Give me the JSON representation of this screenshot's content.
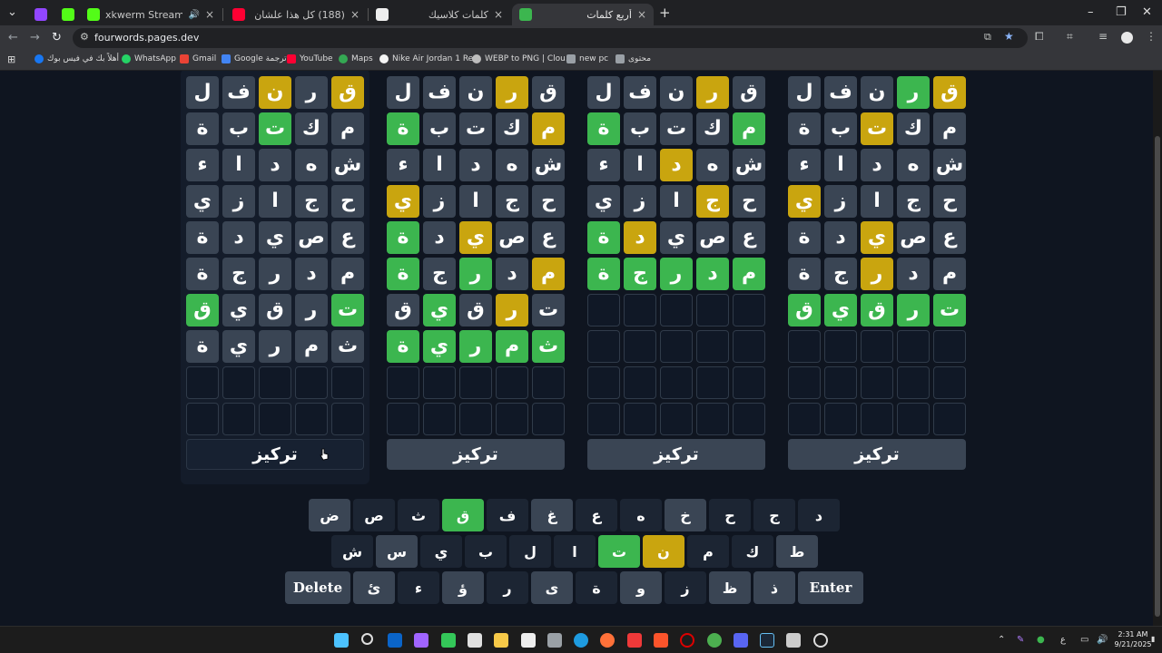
{
  "browser": {
    "tabs": [
      {
        "title": "",
        "active": false
      },
      {
        "title": "xkwerm Stream - Watch Live",
        "active": false
      },
      {
        "title": "(188) كل هذا علشان مخالفة - be",
        "active": false
      },
      {
        "title": "كلمات كلاسيك",
        "active": false
      },
      {
        "title": "أربع كلمات",
        "active": true
      }
    ],
    "new_tab": "+",
    "close_glyph": "×",
    "url": "fourwords.pages.dev",
    "bookmarks": [
      "أهلاً بك في فيس بوك",
      "WhatsApp",
      "Gmail",
      "Google ترجمة",
      "YouTube",
      "Maps",
      "Nike Air Jordan 1 Re...",
      "WEBP to PNG | Clou...",
      "new pc",
      "محتوى"
    ]
  },
  "game": {
    "focus_label": "تركيز",
    "boards": [
      {
        "focused": true,
        "rows": [
          [
            [
              "ق",
              "y"
            ],
            [
              "ر",
              "g"
            ],
            [
              "ن",
              "y"
            ],
            [
              "ف",
              "g"
            ],
            [
              "ل",
              "g"
            ]
          ],
          [
            [
              "م",
              "g"
            ],
            [
              "ك",
              "g"
            ],
            [
              "ت",
              "G"
            ],
            [
              "ب",
              "g"
            ],
            [
              "ة",
              "g"
            ]
          ],
          [
            [
              "ش",
              "g"
            ],
            [
              "ه",
              "g"
            ],
            [
              "د",
              "g"
            ],
            [
              "ا",
              "g"
            ],
            [
              "ء",
              "g"
            ]
          ],
          [
            [
              "ح",
              "g"
            ],
            [
              "ج",
              "g"
            ],
            [
              "ا",
              "g"
            ],
            [
              "ز",
              "g"
            ],
            [
              "ي",
              "g"
            ]
          ],
          [
            [
              "ع",
              "g"
            ],
            [
              "ص",
              "g"
            ],
            [
              "ي",
              "g"
            ],
            [
              "د",
              "g"
            ],
            [
              "ة",
              "g"
            ]
          ],
          [
            [
              "م",
              "g"
            ],
            [
              "د",
              "g"
            ],
            [
              "ر",
              "g"
            ],
            [
              "ج",
              "g"
            ],
            [
              "ة",
              "g"
            ]
          ],
          [
            [
              "ت",
              "G"
            ],
            [
              "ر",
              "g"
            ],
            [
              "ق",
              "g"
            ],
            [
              "ي",
              "g"
            ],
            [
              "ق",
              "G"
            ]
          ],
          [
            [
              "ث",
              "g"
            ],
            [
              "م",
              "g"
            ],
            [
              "ر",
              "g"
            ],
            [
              "ي",
              "g"
            ],
            [
              "ة",
              "g"
            ]
          ],
          [
            [
              "",
              "e"
            ],
            [
              "",
              "e"
            ],
            [
              "",
              "e"
            ],
            [
              "",
              "e"
            ],
            [
              "",
              "e"
            ]
          ],
          [
            [
              "",
              "e"
            ],
            [
              "",
              "e"
            ],
            [
              "",
              "e"
            ],
            [
              "",
              "e"
            ],
            [
              "",
              "e"
            ]
          ]
        ]
      },
      {
        "focused": false,
        "rows": [
          [
            [
              "ق",
              "g"
            ],
            [
              "ر",
              "y"
            ],
            [
              "ن",
              "g"
            ],
            [
              "ف",
              "g"
            ],
            [
              "ل",
              "g"
            ]
          ],
          [
            [
              "م",
              "y"
            ],
            [
              "ك",
              "g"
            ],
            [
              "ت",
              "g"
            ],
            [
              "ب",
              "g"
            ],
            [
              "ة",
              "G"
            ]
          ],
          [
            [
              "ش",
              "g"
            ],
            [
              "ه",
              "g"
            ],
            [
              "د",
              "g"
            ],
            [
              "ا",
              "g"
            ],
            [
              "ء",
              "g"
            ]
          ],
          [
            [
              "ح",
              "g"
            ],
            [
              "ج",
              "g"
            ],
            [
              "ا",
              "g"
            ],
            [
              "ز",
              "g"
            ],
            [
              "ي",
              "y"
            ]
          ],
          [
            [
              "ع",
              "g"
            ],
            [
              "ص",
              "g"
            ],
            [
              "ي",
              "y"
            ],
            [
              "د",
              "g"
            ],
            [
              "ة",
              "G"
            ]
          ],
          [
            [
              "م",
              "y"
            ],
            [
              "د",
              "g"
            ],
            [
              "ر",
              "G"
            ],
            [
              "ج",
              "g"
            ],
            [
              "ة",
              "G"
            ]
          ],
          [
            [
              "ت",
              "g"
            ],
            [
              "ر",
              "y"
            ],
            [
              "ق",
              "g"
            ],
            [
              "ي",
              "G"
            ],
            [
              "ق",
              "g"
            ]
          ],
          [
            [
              "ث",
              "G"
            ],
            [
              "م",
              "G"
            ],
            [
              "ر",
              "G"
            ],
            [
              "ي",
              "G"
            ],
            [
              "ة",
              "G"
            ]
          ],
          [
            [
              "",
              "e"
            ],
            [
              "",
              "e"
            ],
            [
              "",
              "e"
            ],
            [
              "",
              "e"
            ],
            [
              "",
              "e"
            ]
          ],
          [
            [
              "",
              "e"
            ],
            [
              "",
              "e"
            ],
            [
              "",
              "e"
            ],
            [
              "",
              "e"
            ],
            [
              "",
              "e"
            ]
          ]
        ]
      },
      {
        "focused": false,
        "rows": [
          [
            [
              "ق",
              "g"
            ],
            [
              "ر",
              "y"
            ],
            [
              "ن",
              "g"
            ],
            [
              "ف",
              "g"
            ],
            [
              "ل",
              "g"
            ]
          ],
          [
            [
              "م",
              "G"
            ],
            [
              "ك",
              "g"
            ],
            [
              "ت",
              "g"
            ],
            [
              "ب",
              "g"
            ],
            [
              "ة",
              "G"
            ]
          ],
          [
            [
              "ش",
              "g"
            ],
            [
              "ه",
              "g"
            ],
            [
              "د",
              "y"
            ],
            [
              "ا",
              "g"
            ],
            [
              "ء",
              "g"
            ]
          ],
          [
            [
              "ح",
              "g"
            ],
            [
              "ج",
              "y"
            ],
            [
              "ا",
              "g"
            ],
            [
              "ز",
              "g"
            ],
            [
              "ي",
              "g"
            ]
          ],
          [
            [
              "ع",
              "g"
            ],
            [
              "ص",
              "g"
            ],
            [
              "ي",
              "g"
            ],
            [
              "د",
              "y"
            ],
            [
              "ة",
              "G"
            ]
          ],
          [
            [
              "م",
              "G"
            ],
            [
              "د",
              "G"
            ],
            [
              "ر",
              "G"
            ],
            [
              "ج",
              "G"
            ],
            [
              "ة",
              "G"
            ]
          ],
          [
            [
              "",
              "e"
            ],
            [
              "",
              "e"
            ],
            [
              "",
              "e"
            ],
            [
              "",
              "e"
            ],
            [
              "",
              "e"
            ]
          ],
          [
            [
              "",
              "e"
            ],
            [
              "",
              "e"
            ],
            [
              "",
              "e"
            ],
            [
              "",
              "e"
            ],
            [
              "",
              "e"
            ]
          ],
          [
            [
              "",
              "e"
            ],
            [
              "",
              "e"
            ],
            [
              "",
              "e"
            ],
            [
              "",
              "e"
            ],
            [
              "",
              "e"
            ]
          ],
          [
            [
              "",
              "e"
            ],
            [
              "",
              "e"
            ],
            [
              "",
              "e"
            ],
            [
              "",
              "e"
            ],
            [
              "",
              "e"
            ]
          ]
        ]
      },
      {
        "focused": false,
        "rows": [
          [
            [
              "ق",
              "y"
            ],
            [
              "ر",
              "G"
            ],
            [
              "ن",
              "g"
            ],
            [
              "ف",
              "g"
            ],
            [
              "ل",
              "g"
            ]
          ],
          [
            [
              "م",
              "g"
            ],
            [
              "ك",
              "g"
            ],
            [
              "ت",
              "y"
            ],
            [
              "ب",
              "g"
            ],
            [
              "ة",
              "g"
            ]
          ],
          [
            [
              "ش",
              "g"
            ],
            [
              "ه",
              "g"
            ],
            [
              "د",
              "g"
            ],
            [
              "ا",
              "g"
            ],
            [
              "ء",
              "g"
            ]
          ],
          [
            [
              "ح",
              "g"
            ],
            [
              "ج",
              "g"
            ],
            [
              "ا",
              "g"
            ],
            [
              "ز",
              "g"
            ],
            [
              "ي",
              "y"
            ]
          ],
          [
            [
              "ع",
              "g"
            ],
            [
              "ص",
              "g"
            ],
            [
              "ي",
              "y"
            ],
            [
              "د",
              "g"
            ],
            [
              "ة",
              "g"
            ]
          ],
          [
            [
              "م",
              "g"
            ],
            [
              "د",
              "g"
            ],
            [
              "ر",
              "y"
            ],
            [
              "ج",
              "g"
            ],
            [
              "ة",
              "g"
            ]
          ],
          [
            [
              "ت",
              "G"
            ],
            [
              "ر",
              "G"
            ],
            [
              "ق",
              "G"
            ],
            [
              "ي",
              "G"
            ],
            [
              "ق",
              "G"
            ]
          ],
          [
            [
              "",
              "e"
            ],
            [
              "",
              "e"
            ],
            [
              "",
              "e"
            ],
            [
              "",
              "e"
            ],
            [
              "",
              "e"
            ]
          ],
          [
            [
              "",
              "e"
            ],
            [
              "",
              "e"
            ],
            [
              "",
              "e"
            ],
            [
              "",
              "e"
            ],
            [
              "",
              "e"
            ]
          ],
          [
            [
              "",
              "e"
            ],
            [
              "",
              "e"
            ],
            [
              "",
              "e"
            ],
            [
              "",
              "e"
            ],
            [
              "",
              "e"
            ]
          ]
        ]
      }
    ]
  },
  "keyboard": {
    "rows": [
      [
        [
          "د",
          "n"
        ],
        [
          "ج",
          "n"
        ],
        [
          "ح",
          "n"
        ],
        [
          "خ",
          "g"
        ],
        [
          "ه",
          "n"
        ],
        [
          "ع",
          "n"
        ],
        [
          "غ",
          "g"
        ],
        [
          "ف",
          "n"
        ],
        [
          "ق",
          "G"
        ],
        [
          "ث",
          "n"
        ],
        [
          "ص",
          "n"
        ],
        [
          "ض",
          "g"
        ]
      ],
      [
        [
          "ط",
          "g"
        ],
        [
          "ك",
          "n"
        ],
        [
          "م",
          "n"
        ],
        [
          "ن",
          "y"
        ],
        [
          "ت",
          "G"
        ],
        [
          "ا",
          "n"
        ],
        [
          "ل",
          "n"
        ],
        [
          "ب",
          "n"
        ],
        [
          "ي",
          "n"
        ],
        [
          "س",
          "g"
        ],
        [
          "ش",
          "n"
        ]
      ],
      [
        [
          "Enter",
          "w"
        ],
        [
          "ذ",
          "g"
        ],
        [
          "ظ",
          "g"
        ],
        [
          "ز",
          "n"
        ],
        [
          "و",
          "g"
        ],
        [
          "ة",
          "n"
        ],
        [
          "ى",
          "g"
        ],
        [
          "ر",
          "n"
        ],
        [
          "ؤ",
          "g"
        ],
        [
          "ء",
          "n"
        ],
        [
          "ئ",
          "g"
        ],
        [
          "Delete",
          "w"
        ]
      ]
    ]
  },
  "taskbar": {
    "lang": "ع",
    "time": "2:31 AM",
    "date": "9/21/2025"
  }
}
